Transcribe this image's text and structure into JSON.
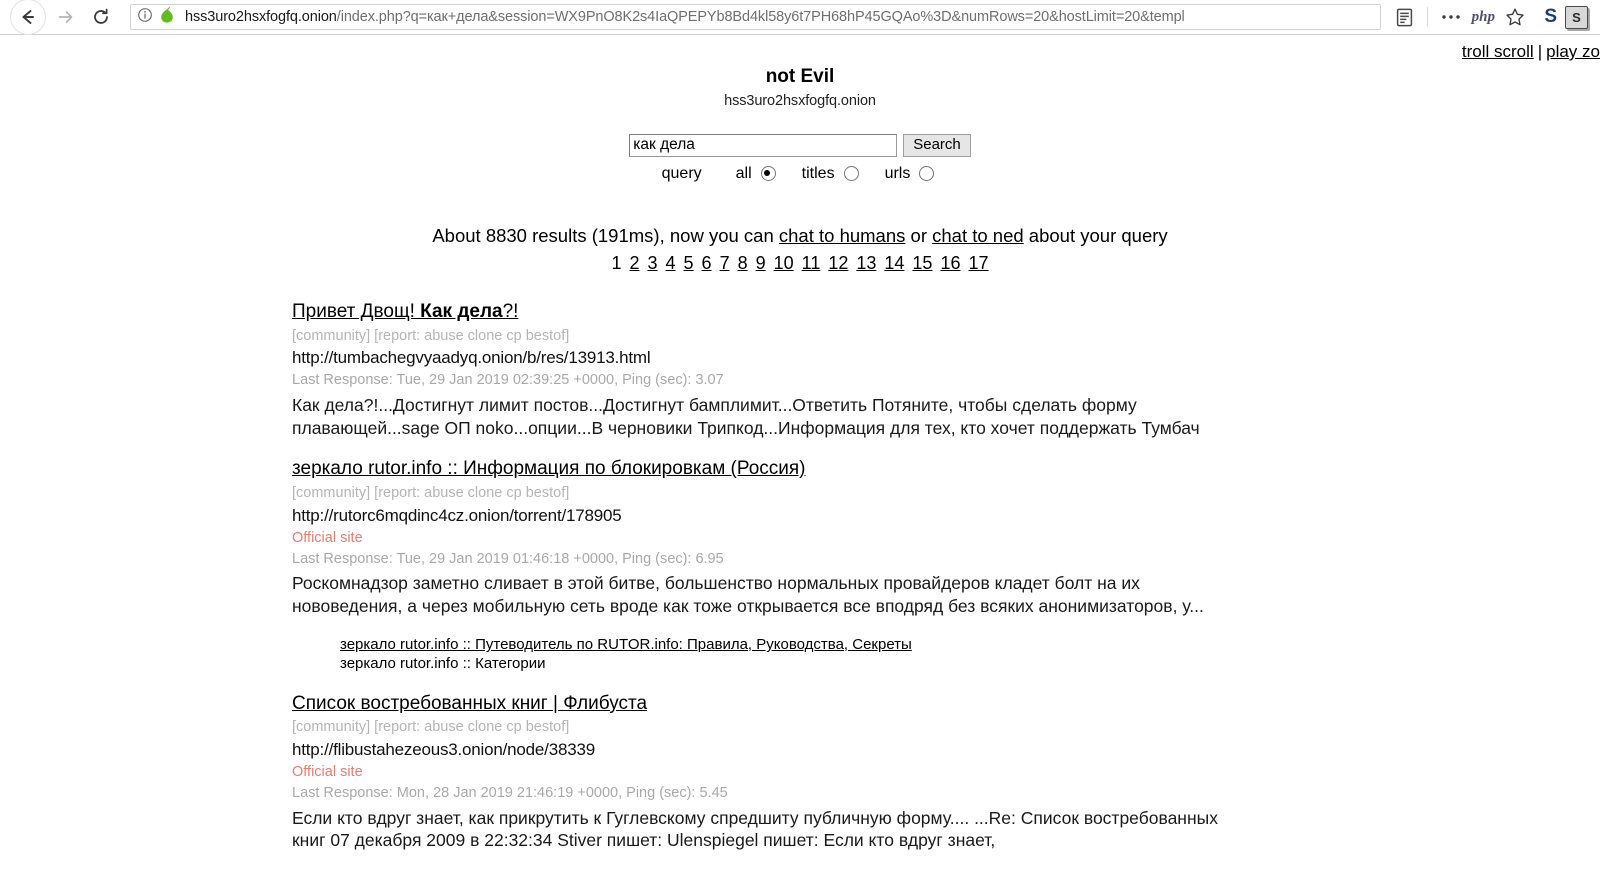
{
  "browser": {
    "nav": {
      "back_label": "Back",
      "forward_label": "Forward",
      "reload_label": "Reload"
    },
    "url": {
      "host": "hss3uro2hsxfogfq.onion",
      "path": "/index.php?q=как+дела&session=WX9PnO8K2s4IaQPEPYb8Bd4kl58y6t7PH68hP45GQAo%3D&numRows=20&hostLimit=20&templ",
      "info_icon": "info-icon",
      "onion_icon": "onion-icon"
    },
    "toolbar": {
      "reader_icon": "reader-mode-icon",
      "menu_icon": "more-dots-icon",
      "php_icon": "php-icon",
      "php_label": "php",
      "bookmark_icon": "star-bookmark-icon",
      "ext1_icon": "extension-s-icon",
      "ext1_label": "S",
      "ext2_icon": "extension-s-box-icon",
      "ext2_label": "S"
    }
  },
  "page": {
    "top_links": [
      {
        "label": "troll scroll"
      },
      {
        "label": "play zo"
      }
    ],
    "top_links_separator": "|",
    "header": {
      "title": "not Evil",
      "domain": "hss3uro2hsxfogfq.onion"
    },
    "search": {
      "value": "как дела",
      "placeholder": "",
      "button_label": "Search",
      "query_label": "query",
      "options": [
        {
          "label": "all",
          "checked": true
        },
        {
          "label": "titles",
          "checked": false
        },
        {
          "label": "urls",
          "checked": false
        }
      ]
    },
    "meta": {
      "prefix": "About 8830 results (191ms), now you can ",
      "link1": "chat to humans",
      "middle": " or ",
      "link2": "chat to ned",
      "suffix": " about your query"
    },
    "pagination": {
      "current": "1",
      "pages": [
        "2",
        "3",
        "4",
        "5",
        "6",
        "7",
        "8",
        "9",
        "10",
        "11",
        "12",
        "13",
        "14",
        "15",
        "16",
        "17"
      ]
    },
    "results": [
      {
        "title_plain_1": "Привет Двощ! ",
        "title_bold": "Как дела",
        "title_plain_2": "?!",
        "tags": "[community] [report: abuse clone cp bestof]",
        "url": "http://tumbachegvyaadyq.onion/b/res/13913.html",
        "official": "",
        "response": "Last Response: Tue, 29 Jan 2019 02:39:25 +0000, Ping (sec): 3.07",
        "snippet": "Как дела?!...Достигнут лимит постов...Достигнут бамплимит...Ответить Потяните, чтобы сделать форму плавающей...sage ОП noko...опции...В черновики Трипкод...Информация для тех, кто хочет поддержать Тумбач",
        "sublinks": []
      },
      {
        "title_plain_1": "зеркало rutor.info :: Информация по блокировкам (Россия)",
        "title_bold": "",
        "title_plain_2": "",
        "tags": "[community] [report: abuse clone cp bestof]",
        "url": "http://rutorc6mqdinc4cz.onion/torrent/178905",
        "official": "Official site",
        "response": "Last Response: Tue, 29 Jan 2019 01:46:18 +0000, Ping (sec): 6.95",
        "snippet": "Роскомнадзор заметно сливает в этой битве, большенство нормальных провайдеров кладет болт на их нововедения, а через мобильную сеть вроде как тоже открывается все вподряд без всяких анонимизаторов, у...",
        "sublinks": [
          "зеркало rutor.info :: Путеводитель по RUTOR.info: Правила, Руководства, Секреты",
          "зеркало rutor.info :: Категории"
        ]
      },
      {
        "title_plain_1": "Список востребованных книг | Флибуста",
        "title_bold": "",
        "title_plain_2": "",
        "tags": "[community] [report: abuse clone cp bestof]",
        "url": "http://flibustahezeous3.onion/node/38339",
        "official": "Official site",
        "response": "Last Response: Mon, 28 Jan 2019 21:46:19 +0000, Ping (sec): 5.45",
        "snippet": "Если кто вдруг знает, как прикрутить к Гуглевскому спредшиту публичную форму.... ...Re: Список востребованных книг  07 декабря 2009  в 22:32:34 Stiver пишет:   Ulenspiegel пишет:   Если кто вдруг знает,",
        "sublinks": []
      }
    ]
  },
  "colors": {
    "official_site": "#ec7b70",
    "meta_gray": "#a9a9a9",
    "tag_gray": "#b5b5b5",
    "onion_green": "#5fb81f"
  }
}
